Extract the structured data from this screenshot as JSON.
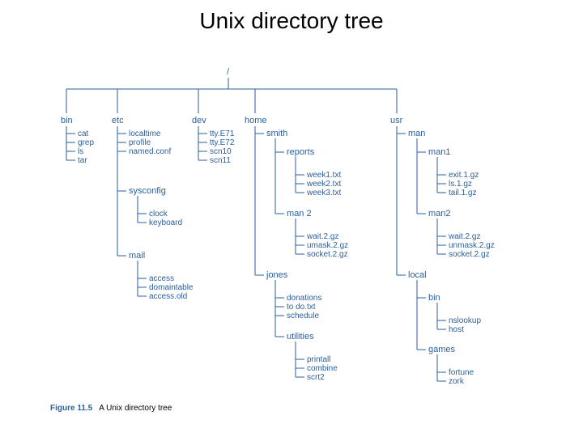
{
  "title": "Unix directory tree",
  "caption_label": "Figure 11.5",
  "caption_text": "A Unix directory tree",
  "tree": {
    "root": "/",
    "bin": {
      "label": "bin",
      "files": [
        "cat",
        "grep",
        "ls",
        "tar"
      ]
    },
    "etc": {
      "label": "etc",
      "files": [
        "localtime",
        "profile",
        "named.conf"
      ],
      "sysconfig": {
        "label": "sysconfig",
        "files": [
          "clock",
          "keyboard"
        ]
      },
      "mail": {
        "label": "mail",
        "files": [
          "access",
          "domaintable",
          "access.old"
        ]
      }
    },
    "dev": {
      "label": "dev",
      "files": [
        "tty.E71",
        "tty.E72",
        "scn10",
        "scn11"
      ]
    },
    "home": {
      "label": "home",
      "smith": {
        "label": "smith",
        "reports": {
          "label": "reports",
          "files": [
            "week1.txt",
            "week2.txt",
            "week3.txt"
          ]
        },
        "man2": {
          "label": "man 2",
          "files": [
            "wait.2.gz",
            "umask.2.gz",
            "socket.2.gz"
          ]
        }
      },
      "jones": {
        "label": "jones",
        "files": [
          "donations",
          "to do.txt",
          "schedule"
        ],
        "utilities": {
          "label": "utilities",
          "files": [
            "printall",
            "combine",
            "scrt2"
          ]
        }
      }
    },
    "usr": {
      "label": "usr",
      "man": {
        "label": "man",
        "man1": {
          "label": "man1",
          "files": [
            "exit.1.gz",
            "ls.1.gz",
            "tail.1.gz"
          ]
        },
        "man2": {
          "label": "man2",
          "files": [
            "wait.2.gz",
            "unmask.2.gz",
            "socket.2.gz"
          ]
        }
      },
      "local": {
        "label": "local",
        "bin": {
          "label": "bin",
          "files": [
            "nslookup",
            "host"
          ]
        },
        "games": {
          "label": "games",
          "files": [
            "fortune",
            "zork"
          ]
        }
      }
    }
  }
}
